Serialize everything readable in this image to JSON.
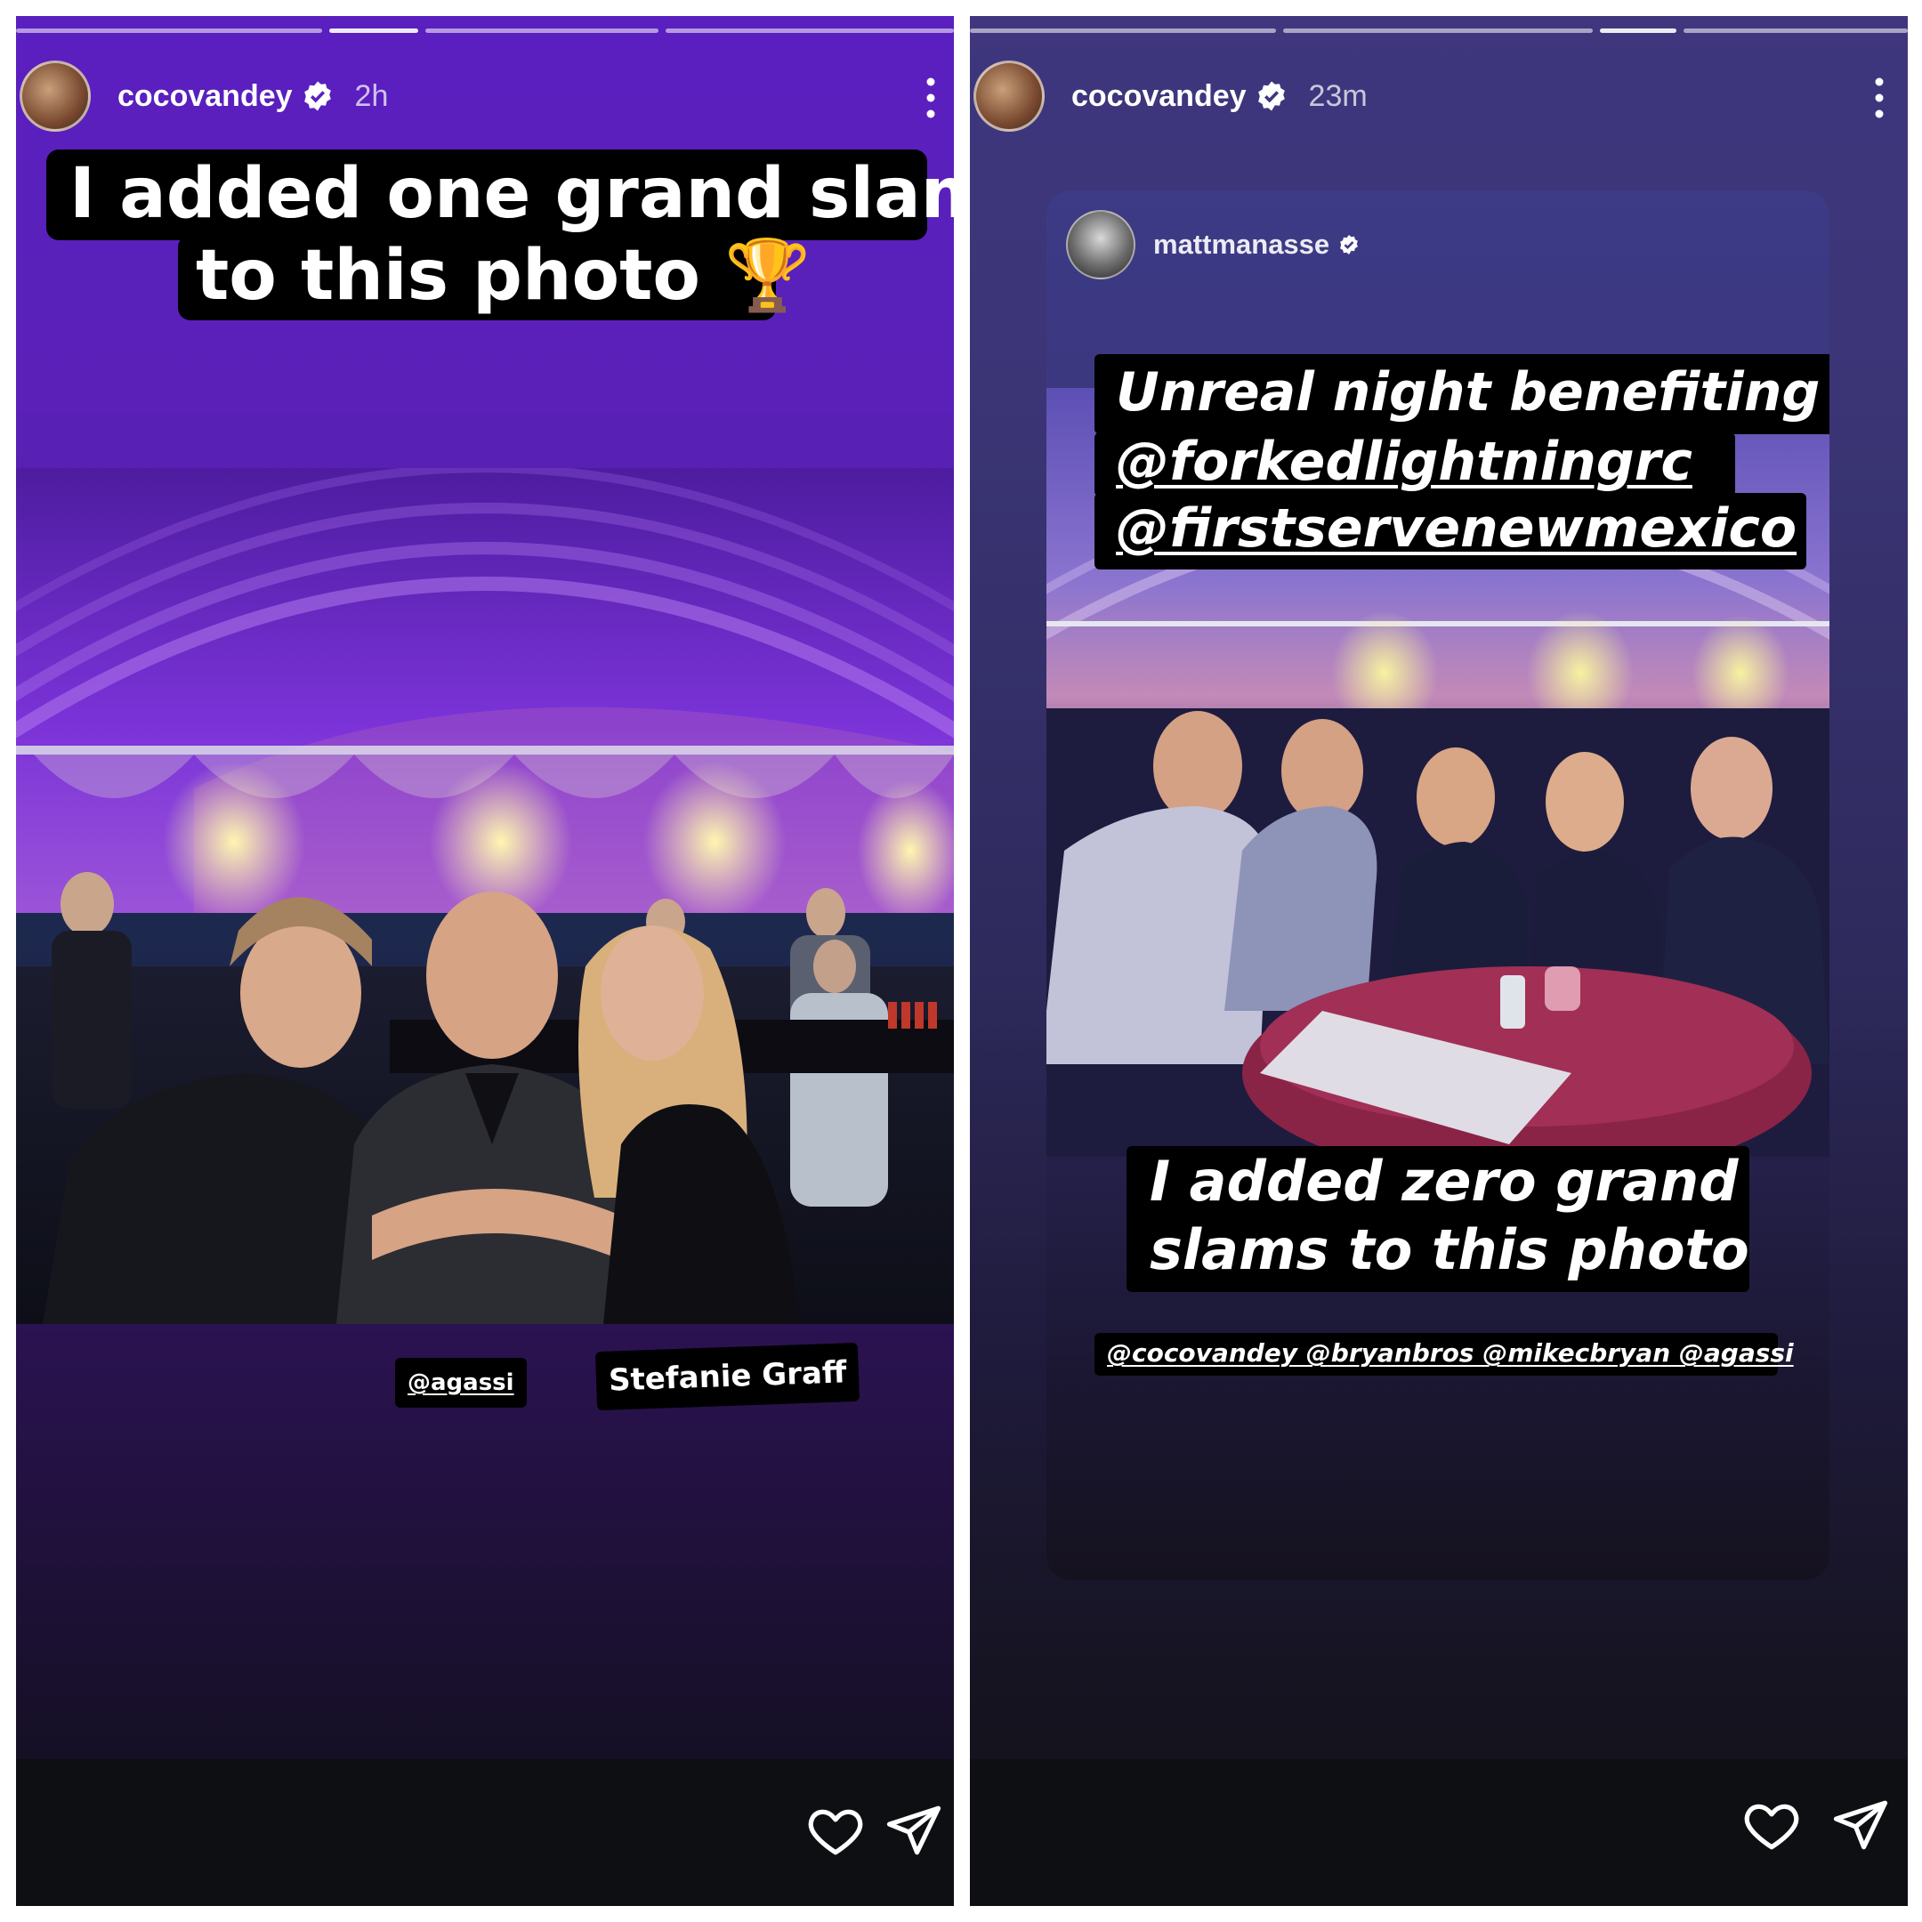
{
  "left_story": {
    "username": "cocovandey",
    "time": "2h",
    "caption_line1": "I added one grand slam",
    "caption_line2": "to this photo",
    "caption_emoji": "🏆",
    "tag_agassi": "@agassi",
    "tag_graf": "Stefanie Graff",
    "icons": [
      "verified-icon",
      "more-icon",
      "heart-icon",
      "send-icon"
    ]
  },
  "right_story": {
    "username": "cocovandey",
    "time": "23m",
    "shared_post": {
      "username": "mattmanasse",
      "caption_line1": "Unreal night benefiting",
      "caption_line2": "@forkedlightningrc",
      "caption_line3": "@firstservenewmexico",
      "overlay_line1": "I added zero grand",
      "overlay_line2": "slams to this photo",
      "mentions": "@cocovandey @bryanbros @mikecbryan @agassi"
    },
    "icons": [
      "verified-icon",
      "more-icon",
      "heart-icon",
      "send-icon"
    ]
  },
  "colors": {
    "left_bg": "#5a1fbf",
    "right_bg": "#3f367e",
    "sticker_bg": "#000000",
    "bottom_bar": "#0d0f13"
  }
}
